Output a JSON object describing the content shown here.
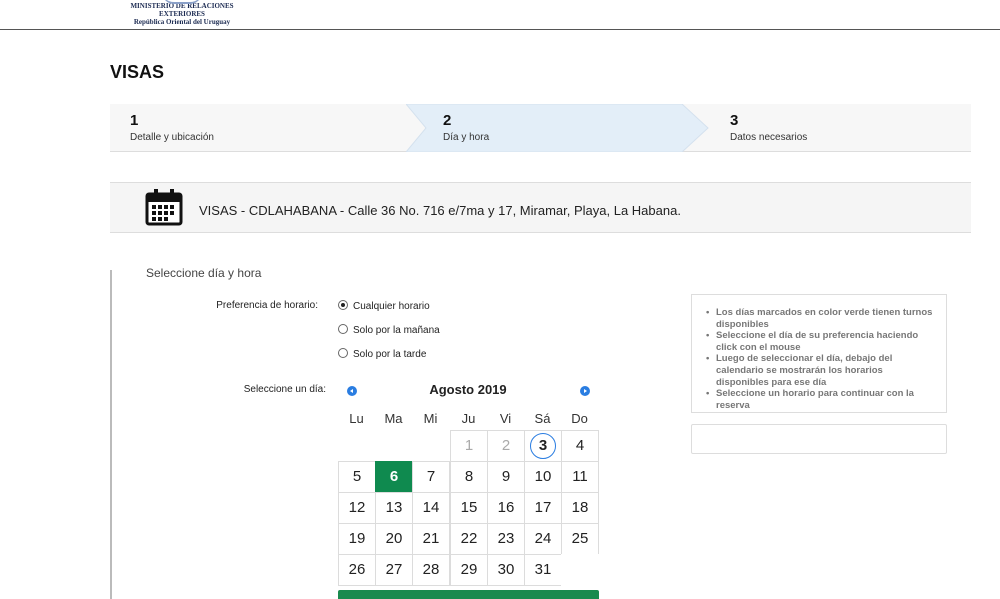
{
  "header": {
    "org_line1": "MINISTERIO DE RELACIONES EXTERIORES",
    "org_line2": "República Oriental del Uruguay"
  },
  "page": {
    "title": "VISAS"
  },
  "steps": [
    {
      "number": "1",
      "label": "Detalle y ubicación",
      "active": false
    },
    {
      "number": "2",
      "label": "Día y hora",
      "active": true
    },
    {
      "number": "3",
      "label": "Datos necesarios",
      "active": false
    }
  ],
  "location": {
    "icon": "calendar-icon",
    "text": "VISAS - CDLAHABANA - Calle 36 No. 716 e/7ma y 17, Miramar, Playa, La Habana."
  },
  "form": {
    "section_title": "Seleccione día y hora",
    "preference_label": "Preferencia de horario:",
    "options": [
      {
        "label": "Cualquier horario",
        "checked": true
      },
      {
        "label": "Solo por la mañana",
        "checked": false
      },
      {
        "label": "Solo por la tarde",
        "checked": false
      }
    ],
    "day_label": "Seleccione un día:"
  },
  "calendar": {
    "month": "Agosto 2019",
    "weekdays": [
      "Lu",
      "Ma",
      "Mi",
      "Ju",
      "Vi",
      "Sá",
      "Do"
    ],
    "selected_day": "6",
    "today_day": "3",
    "disabled_days": [
      "1",
      "2"
    ],
    "weeks": [
      [
        "",
        "",
        "",
        "1",
        "2",
        "3",
        "4"
      ],
      [
        "5",
        "6",
        "7",
        "8",
        "9",
        "10",
        "11"
      ],
      [
        "12",
        "13",
        "14",
        "15",
        "16",
        "17",
        "18"
      ],
      [
        "19",
        "20",
        "21",
        "22",
        "23",
        "24",
        "25"
      ],
      [
        "26",
        "27",
        "28",
        "29",
        "30",
        "31",
        ""
      ]
    ],
    "colors": {
      "selected": "#0f8a4f",
      "today_ring": "#2a7de1",
      "nav": "#2a7de1"
    }
  },
  "info": {
    "items": [
      "Los días marcados en color verde tienen turnos disponibles",
      "Seleccione el día de su preferencia haciendo click con el mouse",
      "Luego de seleccionar el día, debajo del calendario se mostrarán los horarios disponibles para ese día",
      "Seleccione un horario para continuar con la reserva"
    ]
  }
}
